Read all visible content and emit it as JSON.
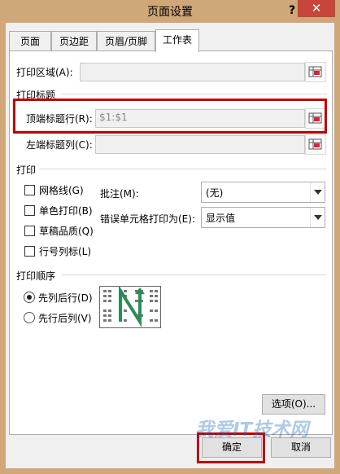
{
  "window": {
    "title": "页面设置",
    "help": "?",
    "close": "✕"
  },
  "tabs": [
    "页面",
    "页边距",
    "页眉/页脚",
    "工作表"
  ],
  "print_area": {
    "label": "打印区域(A):",
    "value": ""
  },
  "print_titles": {
    "heading": "打印标题",
    "top_rows_label": "顶端标题行(R):",
    "top_rows_value": "$1:$1",
    "left_cols_label": "左端标题列(C):",
    "left_cols_value": ""
  },
  "print": {
    "heading": "打印",
    "gridlines": "网格线(G)",
    "black_white": "单色打印(B)",
    "draft": "草稿品质(Q)",
    "row_col_headings": "行号列标(L)",
    "comments_label": "批注(M):",
    "comments_value": "(无)",
    "errors_label": "错误单元格打印为(E):",
    "errors_value": "显示值"
  },
  "page_order": {
    "heading": "打印顺序",
    "down_then_over": "先列后行(D)",
    "over_then_down": "先行后列(V)",
    "selected": "down_then_over"
  },
  "buttons": {
    "options": "选项(O)...",
    "ok": "确定",
    "cancel": "取消"
  },
  "watermark": {
    "text": "我爱IT技术网"
  },
  "colors": {
    "highlight": "#c00000",
    "close": "#c7463b",
    "frame": "#cfa779"
  },
  "icons": [
    "range-picker-icon",
    "page-order-preview-icon"
  ]
}
